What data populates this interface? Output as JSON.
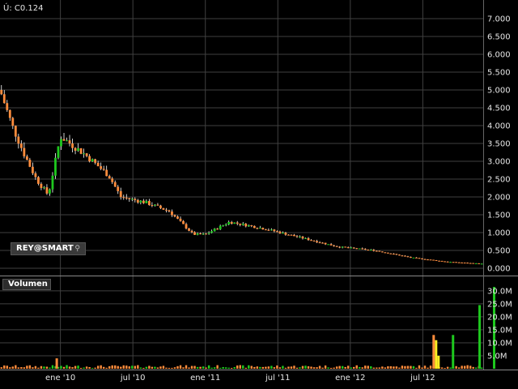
{
  "header": {
    "last_price": "Ú: C0.124"
  },
  "badge": {
    "label": "REY@SMART",
    "icon": "magnifier-icon"
  },
  "volume_panel": {
    "label": "Volumen"
  },
  "colors": {
    "up": "#1ec81e",
    "down": "#ff8c3c",
    "highlight": "#ffee22",
    "grid": "#404040",
    "wick": "#ffffff"
  },
  "chart_data": [
    {
      "type": "candlestick",
      "title": "",
      "ylim": [
        0,
        7
      ],
      "yticks": [
        "0.000",
        "0.500",
        "1.000",
        "1.500",
        "2.000",
        "2.500",
        "3.000",
        "3.500",
        "4.000",
        "4.500",
        "5.000",
        "5.500",
        "6.000",
        "6.500",
        "7.000"
      ],
      "xticks": [
        "ene '10",
        "jul '10",
        "ene '11",
        "jul '11",
        "ene '12",
        "jul '12"
      ],
      "xlim": [
        "2009-08",
        "2012-12"
      ],
      "grid": true,
      "approx_close_path": [
        {
          "date": "2009-08",
          "value": 5.0
        },
        {
          "date": "2009-09",
          "value": 4.0
        },
        {
          "date": "2009-10",
          "value": 3.2
        },
        {
          "date": "2009-11",
          "value": 2.5
        },
        {
          "date": "2009-12",
          "value": 2.05
        },
        {
          "date": "2010-01",
          "value": 3.7
        },
        {
          "date": "2010-03",
          "value": 3.2
        },
        {
          "date": "2010-05",
          "value": 2.6
        },
        {
          "date": "2010-06",
          "value": 2.0
        },
        {
          "date": "2010-08",
          "value": 1.85
        },
        {
          "date": "2010-10",
          "value": 1.6
        },
        {
          "date": "2010-12",
          "value": 0.95
        },
        {
          "date": "2011-01",
          "value": 0.95
        },
        {
          "date": "2011-03",
          "value": 1.3
        },
        {
          "date": "2011-06",
          "value": 1.1
        },
        {
          "date": "2011-09",
          "value": 0.85
        },
        {
          "date": "2011-12",
          "value": 0.6
        },
        {
          "date": "2012-03",
          "value": 0.5
        },
        {
          "date": "2012-06",
          "value": 0.3
        },
        {
          "date": "2012-09",
          "value": 0.18
        },
        {
          "date": "2012-12",
          "value": 0.124
        }
      ]
    },
    {
      "type": "bar",
      "title": "Volumen",
      "ylim": [
        0,
        32
      ],
      "yticks": [
        "5.0M",
        "10.0M",
        "15.0M",
        "20.0M",
        "25.0M",
        "30.0M"
      ],
      "approx_spikes": [
        {
          "date": "2010-01",
          "value": 4.0,
          "color": "down"
        },
        {
          "date": "2012-08",
          "value": 13.0,
          "color": "down"
        },
        {
          "date": "2012-08",
          "value": 11.0,
          "color": "highlight"
        },
        {
          "date": "2012-08",
          "value": 5.0,
          "color": "highlight"
        },
        {
          "date": "2012-09",
          "value": 13.0,
          "color": "up"
        },
        {
          "date": "2012-11",
          "value": 24.5,
          "color": "up"
        },
        {
          "date": "2012-12",
          "value": 31.5,
          "color": "up"
        }
      ]
    }
  ]
}
